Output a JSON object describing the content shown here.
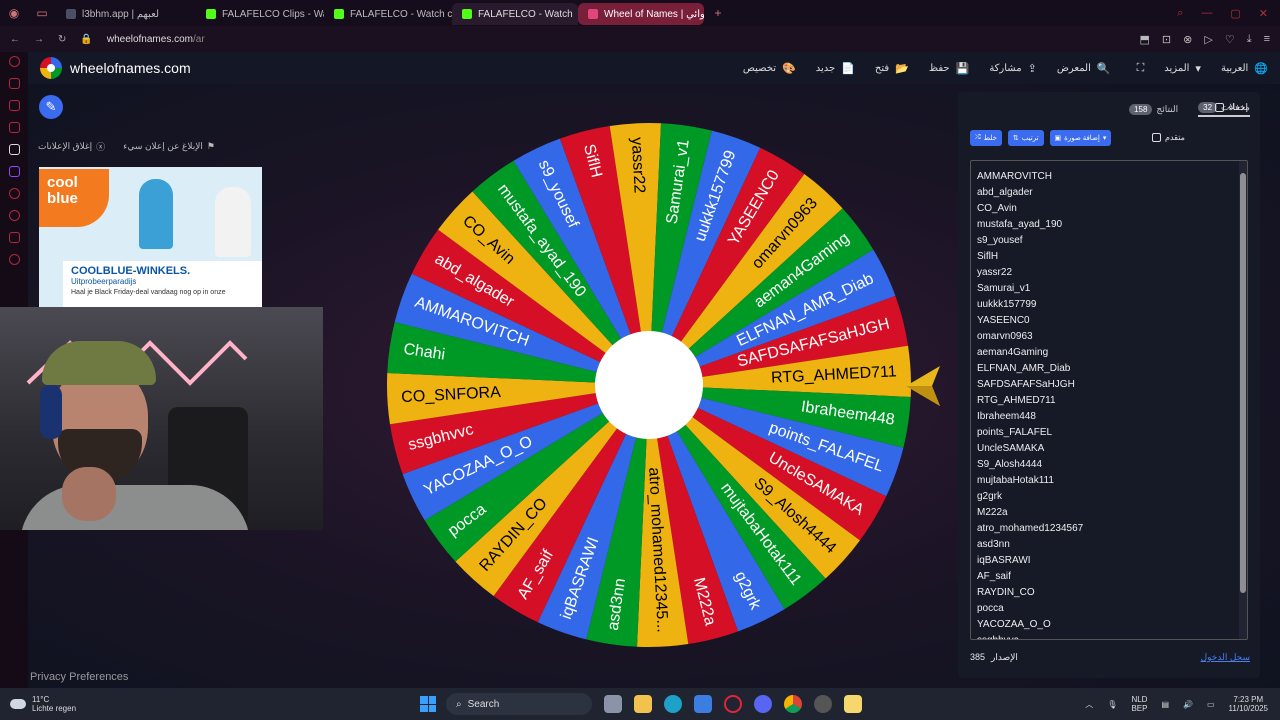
{
  "browser": {
    "tabs": [
      {
        "label": "l3bhm.app | لعبهم",
        "color": "#4a4f66"
      },
      {
        "label": "FALAFELCO Clips - Watc",
        "color": "#53fc18"
      },
      {
        "label": "FALAFELCO - Watch clip",
        "color": "#53fc18"
      },
      {
        "label": "FALAFELCO - Watch",
        "color": "#53fc18"
      },
      {
        "label": "Wheel of Names | شوائي",
        "color": "#e0457b"
      }
    ],
    "url_domain": "wheelofnames.com",
    "url_path": "/ar"
  },
  "site": {
    "brand": "wheelofnames.com",
    "menu": [
      {
        "label": "العربية",
        "icon": "globe-icon",
        "glyph": "🌐"
      },
      {
        "label": "المزيد",
        "icon": "chevron-down-icon",
        "glyph": "▾"
      },
      {
        "label": "",
        "icon": "fullscreen-icon",
        "glyph": "⛶"
      },
      {
        "label": "المعرض",
        "icon": "search-icon",
        "glyph": "🔍"
      },
      {
        "label": "مشاركة",
        "icon": "share-icon",
        "glyph": "⇪"
      },
      {
        "label": "حفظ",
        "icon": "save-icon",
        "glyph": "💾"
      },
      {
        "label": "فتح",
        "icon": "folder-icon",
        "glyph": "📂"
      },
      {
        "label": "جديد",
        "icon": "new-file-icon",
        "glyph": "📄"
      },
      {
        "label": "تخصيص",
        "icon": "palette-icon",
        "glyph": "🎨"
      }
    ],
    "ad_links": {
      "report": "الإبلاغ عن إعلان سيء",
      "close": "إغلاق الإعلانات"
    },
    "ad": {
      "brand_line1": "cool",
      "brand_line2": "blue",
      "headline": "COOLBLUE-WINKELS.",
      "subline": "Uitprobeerparadijs",
      "body": "Haal je Black Friday-deal vandaag nog op in onze"
    },
    "privacy": "Privacy Preferences"
  },
  "wheel": {
    "colors": [
      "#3369e8",
      "#d50f25",
      "#eeb211",
      "#009925"
    ],
    "segments": [
      "AMMAROVITCH",
      "abd_algader",
      "CO_Avin",
      "mustafa_ayad_190",
      "s9_yousef",
      "SiflH",
      "yassr22",
      "Samurai_v1",
      "uukkk157799",
      "YASEENC0",
      "omarvn0963",
      "aeman4Gaming",
      "ELFNAN_AMR_Diab",
      "SAFDSAFAFSaHJGH",
      "RTG_AHMED711",
      "Ibraheem448",
      "points_FALAFEL",
      "UncleSAMAKA",
      "S9_Alosh4444",
      "mujtabaHotak111",
      "g2grk",
      "M222a",
      "atro_mohamed12345...",
      "asd3nn",
      "iqBASRAWI",
      "AF_saif",
      "RAYDIN_CO",
      "pocca",
      "YACOZAA_O_O",
      "ssgbhvvc",
      "CO_SNFORA",
      "Chahi"
    ]
  },
  "panel": {
    "tab_entries": {
      "label": "مدخلات",
      "count": "32"
    },
    "tab_results": {
      "label": "النتائج",
      "count": "158"
    },
    "hide": "إخفاء",
    "buttons": {
      "shuffle": "خلط",
      "sort": "ترتيب",
      "add_image": "إضافة صورة"
    },
    "advanced": "متقدم",
    "entries": [
      "AMMAROVITCH",
      "abd_algader",
      "CO_Avin",
      "mustafa_ayad_190",
      "s9_yousef",
      "SiflH",
      "yassr22",
      "Samurai_v1",
      "uukkk157799",
      "YASEENC0",
      "omarvn0963",
      "aeman4Gaming",
      "ELFNAN_AMR_Diab",
      "SAFDSAFAFSaHJGH",
      "RTG_AHMED711",
      "Ibraheem448",
      "points_FALAFEL",
      "UncleSAMAKA",
      "S9_Alosh4444",
      "mujtabaHotak111",
      "g2grk",
      "M222a",
      "atro_mohamed1234567",
      "asd3nn",
      "iqBASRAWI",
      "AF_saif",
      "RAYDIN_CO",
      "pocca",
      "YACOZAA_O_O",
      "ssgbhvvc"
    ],
    "version_label": "الإصدار",
    "version": "385",
    "login": "سجل الدخول"
  },
  "taskbar": {
    "weather_temp": "11°C",
    "weather_desc": "Lichte regen",
    "search": "Search",
    "lang1": "NLD",
    "lang2": "BEP",
    "time": "7:23 PM",
    "date": "11/10/2025"
  }
}
